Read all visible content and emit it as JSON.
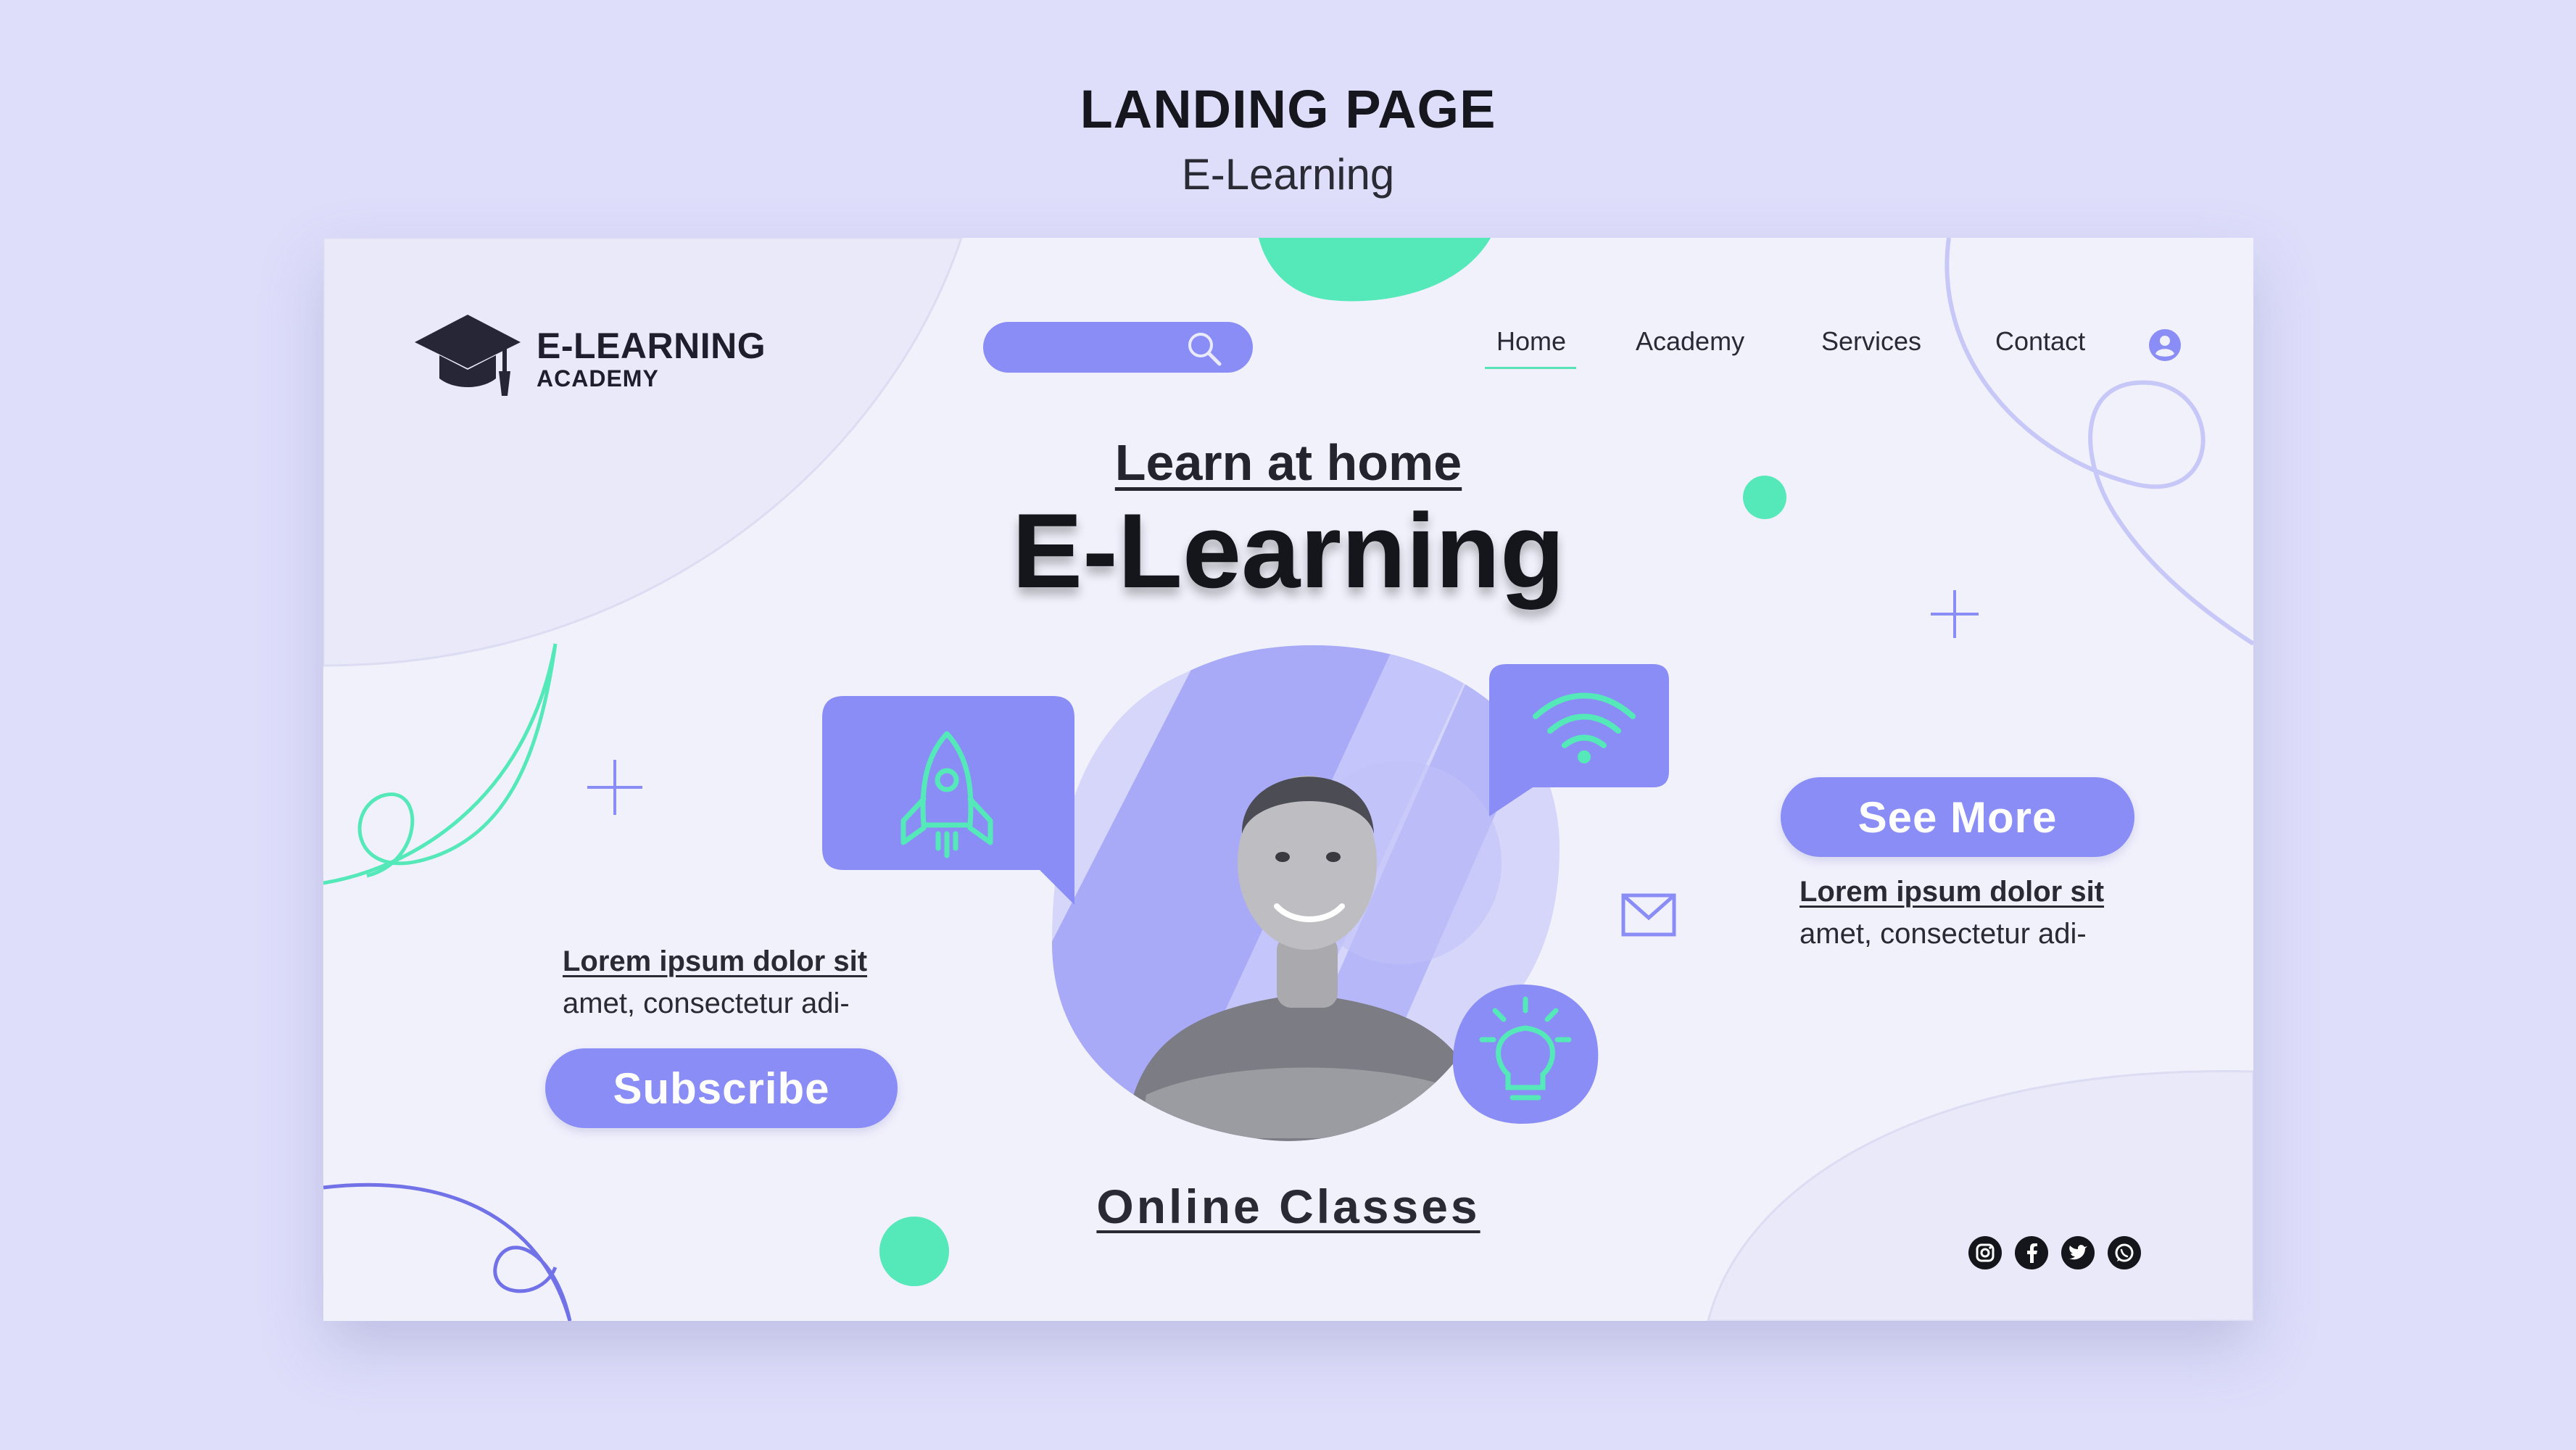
{
  "header": {
    "title": "LANDING PAGE",
    "subtitle": "E-Learning"
  },
  "logo": {
    "line1": "E-LEARNING",
    "line2": "ACADEMY",
    "icon": "graduation-cap-icon"
  },
  "search": {
    "value": "",
    "placeholder": "",
    "icon": "search-icon"
  },
  "nav": {
    "items": [
      {
        "label": "Home",
        "active": true
      },
      {
        "label": "Academy",
        "active": false
      },
      {
        "label": "Services",
        "active": false
      },
      {
        "label": "Contact",
        "active": false
      }
    ],
    "user_icon": "user-icon"
  },
  "hero": {
    "subtitle": "Learn at home",
    "title": "E-Learning"
  },
  "left_block": {
    "lorem_bold": "Lorem ipsum dolor sit",
    "lorem_text": "amet, consectetur adi-",
    "button_label": "Subscribe"
  },
  "right_block": {
    "button_label": "See More",
    "lorem_bold": "Lorem ipsum dolor sit",
    "lorem_text": "amet, consectetur adi-"
  },
  "icons": [
    "rocket-icon",
    "wifi-icon",
    "mail-icon",
    "lightbulb-icon"
  ],
  "footer": {
    "caption": "Online Classes",
    "social": [
      "instagram-icon",
      "facebook-icon",
      "twitter-icon",
      "whatsapp-icon"
    ]
  },
  "colors": {
    "background": "#dedefb",
    "canvas": "#f1f1fc",
    "accent_purple": "#8a8df5",
    "accent_green": "#55e8b8",
    "text_dark": "#15151c"
  }
}
